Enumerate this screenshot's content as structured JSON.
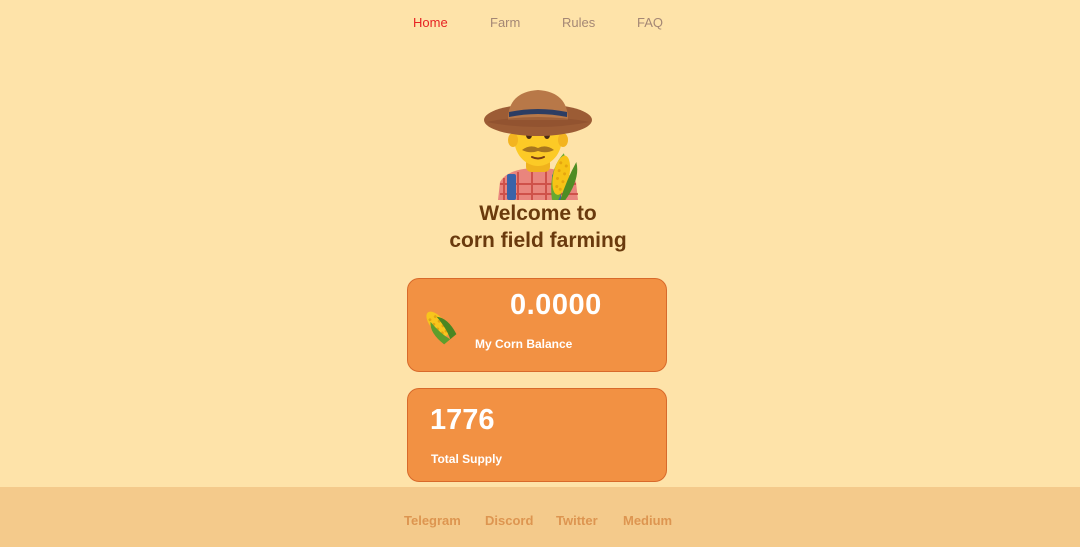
{
  "nav": {
    "items": [
      {
        "label": "Home",
        "active": true
      },
      {
        "label": "Farm",
        "active": false
      },
      {
        "label": "Rules",
        "active": false
      },
      {
        "label": "FAQ",
        "active": false
      }
    ]
  },
  "hero": {
    "illustration": "farmer-with-corn-icon",
    "line1": "Welcome to",
    "line2": "corn field farming"
  },
  "balance_card": {
    "icon": "corn-icon",
    "value": "0.0000",
    "label": "My Corn Balance"
  },
  "supply_card": {
    "value": "1776",
    "label": "Total Supply"
  },
  "footer": {
    "links": [
      "Telegram",
      "Discord",
      "Twitter",
      "Medium"
    ]
  },
  "colors": {
    "background": "#fee3a9",
    "card": "#f29143",
    "nav_active": "#e62323",
    "nav_inactive": "#a48775",
    "heading": "#6a3a0d",
    "footer_bg": "#f4ca8b",
    "footer_link": "#dd9550"
  }
}
